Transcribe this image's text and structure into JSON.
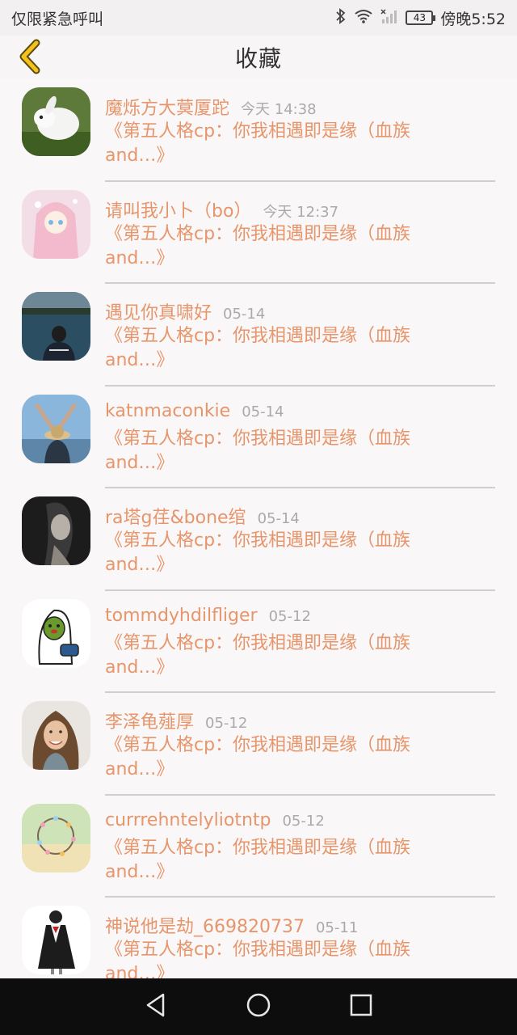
{
  "status_bar": {
    "carrier_text": "仅限紧急呼叫",
    "battery_level": "43",
    "time": "傍晚5:52"
  },
  "header": {
    "title": "收藏",
    "back_icon": "chevron-left-icon",
    "accent_color": "#f2c21b"
  },
  "colors": {
    "name": "#e7956a",
    "time": "#aaaaaa"
  },
  "items": [
    {
      "name": "魔烁方大蓂厦跎",
      "time": "今天 14:38",
      "preview": "《第五人格cp：你我相遇即是缘（血族and…》"
    },
    {
      "name": "请叫我小卜（bo）",
      "time": "今天 12:37",
      "preview": "《第五人格cp：你我相遇即是缘（血族and…》"
    },
    {
      "name": "遇见你真啸好",
      "time": "05-14",
      "preview": "《第五人格cp：你我相遇即是缘（血族and…》"
    },
    {
      "name": "katnmaconkie",
      "time": "05-14",
      "preview": "《第五人格cp：你我相遇即是缘（血族and…》"
    },
    {
      "name": "ra塔g荏&bone绾",
      "time": "05-14",
      "preview": "《第五人格cp：你我相遇即是缘（血族and…》"
    },
    {
      "name": "tommdyhdilfliger",
      "time": "05-12",
      "preview": "《第五人格cp：你我相遇即是缘（血族and…》"
    },
    {
      "name": "李泽龟薤厚",
      "time": "05-12",
      "preview": "《第五人格cp：你我相遇即是缘（血族and…》"
    },
    {
      "name": "currrehntelyliotntp",
      "time": "05-12",
      "preview": "《第五人格cp：你我相遇即是缘（血族and…》"
    },
    {
      "name": "神说他是劫_669820737",
      "time": "05-11",
      "preview": "《第五人格cp：你我相遇即是缘（血族and…》"
    }
  ],
  "nav_bar": {
    "back_icon": "triangle-back-icon",
    "home_icon": "circle-home-icon",
    "recents_icon": "square-recents-icon"
  }
}
